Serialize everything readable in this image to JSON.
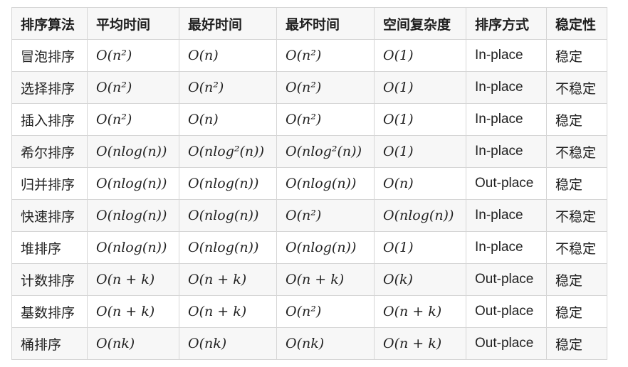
{
  "table": {
    "headers": [
      "排序算法",
      "平均时间",
      "最好时间",
      "最坏时间",
      "空间复杂度",
      "排序方式",
      "稳定性"
    ],
    "rows": [
      [
        "冒泡排序",
        "O(n²)",
        "O(n)",
        "O(n²)",
        "O(1)",
        "In-place",
        "稳定"
      ],
      [
        "选择排序",
        "O(n²)",
        "O(n²)",
        "O(n²)",
        "O(1)",
        "In-place",
        "不稳定"
      ],
      [
        "插入排序",
        "O(n²)",
        "O(n)",
        "O(n²)",
        "O(1)",
        "In-place",
        "稳定"
      ],
      [
        "希尔排序",
        "O(nlog(n))",
        "O(nlog²(n))",
        "O(nlog²(n))",
        "O(1)",
        "In-place",
        "不稳定"
      ],
      [
        "归并排序",
        "O(nlog(n))",
        "O(nlog(n))",
        "O(nlog(n))",
        "O(n)",
        "Out-place",
        "稳定"
      ],
      [
        "快速排序",
        "O(nlog(n))",
        "O(nlog(n))",
        "O(n²)",
        "O(nlog(n))",
        "In-place",
        "不稳定"
      ],
      [
        "堆排序",
        "O(nlog(n))",
        "O(nlog(n))",
        "O(nlog(n))",
        "O(1)",
        "In-place",
        "不稳定"
      ],
      [
        "计数排序",
        "O(n + k)",
        "O(n + k)",
        "O(n + k)",
        "O(k)",
        "Out-place",
        "稳定"
      ],
      [
        "基数排序",
        "O(n + k)",
        "O(n + k)",
        "O(n²)",
        "O(n + k)",
        "Out-place",
        "稳定"
      ],
      [
        "桶排序",
        "O(nk)",
        "O(nk)",
        "O(nk)",
        "O(n + k)",
        "Out-place",
        "稳定"
      ]
    ]
  }
}
